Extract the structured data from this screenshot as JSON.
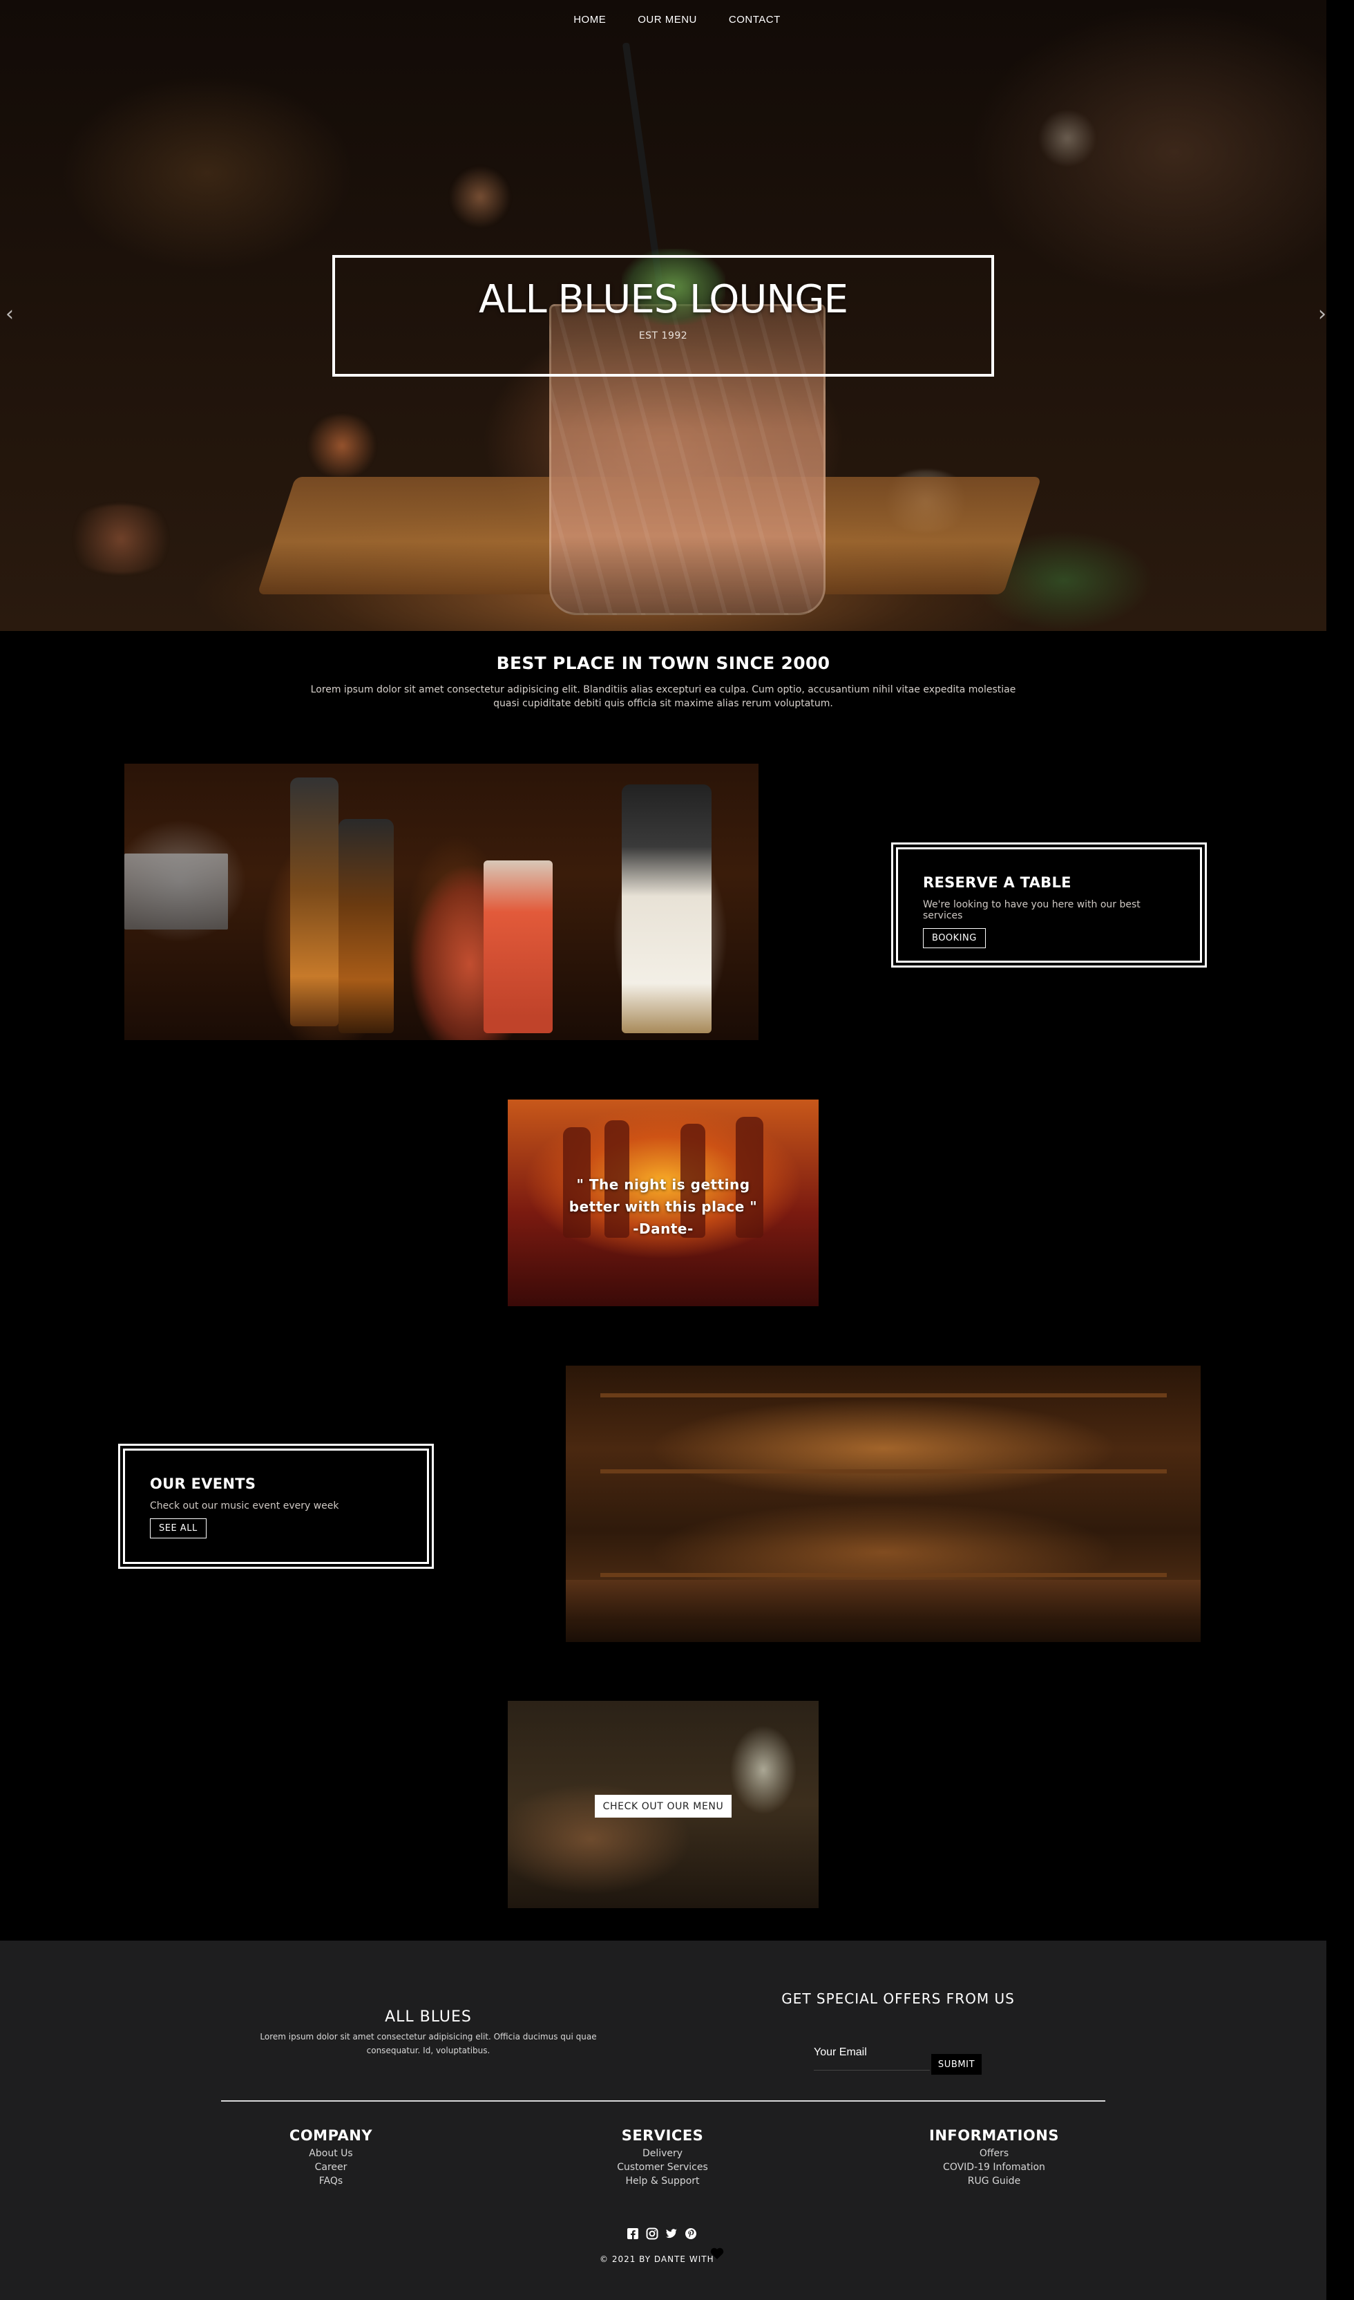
{
  "nav": {
    "items": [
      "HOME",
      "OUR MENU",
      "CONTACT"
    ]
  },
  "hero": {
    "title": "ALL BLUES LOUNGE",
    "est": "EST 1992",
    "prev_icon": "chevron-left-icon",
    "next_icon": "chevron-right-icon"
  },
  "intro": {
    "heading": "BEST PLACE IN TOWN SINCE 2000",
    "text": "Lorem ipsum dolor sit amet consectetur adipisicing elit. Blanditiis alias excepturi ea culpa. Cum optio, accusantium nihil vitae expedita molestiae quasi cupiditate debiti quis officia sit maxime alias rerum voluptatum."
  },
  "reserve": {
    "title": "RESERVE A TABLE",
    "text": "We're looking to have you here with our best services",
    "button": "BOOKING"
  },
  "quote": {
    "line1": "\" The night is getting",
    "line2": "better with this place \"",
    "author": "-Dante-"
  },
  "events": {
    "title": "OUR EVENTS",
    "text": "Check out our music event every week",
    "button": "SEE ALL"
  },
  "menu_cta": {
    "button": "CHECK OUT OUR MENU"
  },
  "footer": {
    "brand": {
      "title": "ALL BLUES",
      "text": "Lorem ipsum dolor sit amet consectetur adipisicing elit. Officia ducimus qui quae consequatur. Id, voluptatibus."
    },
    "offers": {
      "title": "GET SPECIAL OFFERS FROM US",
      "email_placeholder": "Your Email",
      "submit": "SUBMIT"
    },
    "columns": [
      {
        "title": "COMPANY",
        "links": [
          "About Us",
          "Career",
          "FAQs"
        ]
      },
      {
        "title": "SERVICES",
        "links": [
          "Delivery",
          "Customer Services",
          "Help & Support"
        ]
      },
      {
        "title": "INFORMATIONS",
        "links": [
          "Offers",
          "COVID-19 Infomation",
          "RUG Guide"
        ]
      }
    ],
    "socials": [
      "facebook-icon",
      "instagram-icon",
      "twitter-icon",
      "pinterest-icon"
    ],
    "copyright": "© 2021 BY DANTE WITH"
  },
  "colors": {
    "background": "#000000",
    "footer_bg": "#1e1e1f",
    "text": "#ffffff"
  }
}
